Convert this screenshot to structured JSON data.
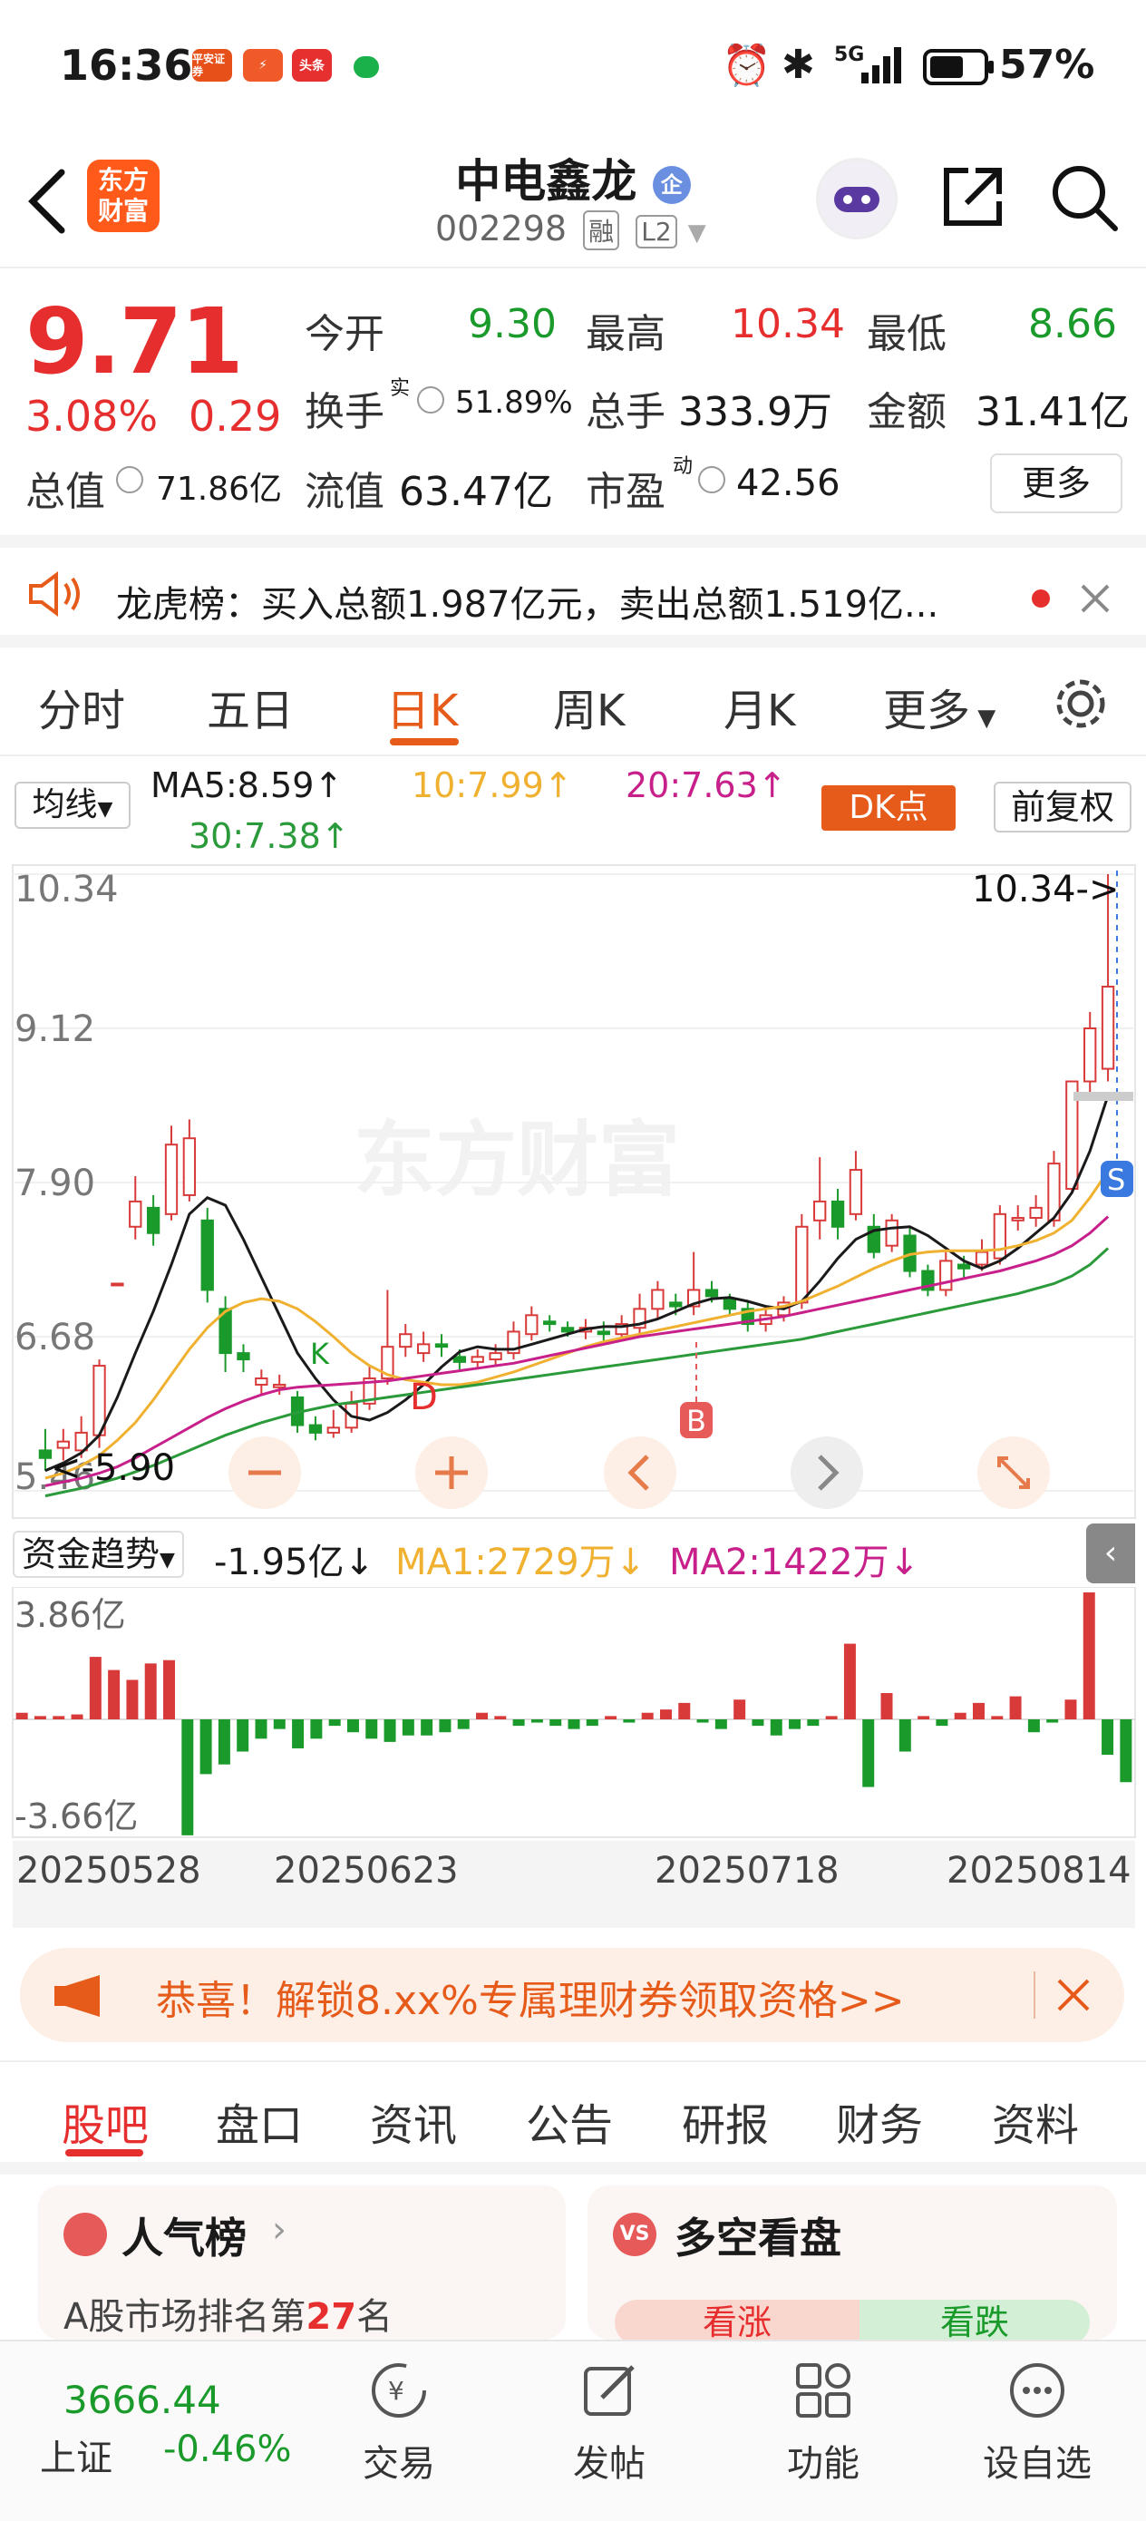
{
  "status_bar": {
    "time": "16:36",
    "apps": [
      "平安证券",
      "",
      "头条",
      ""
    ],
    "network": "5G",
    "battery": "57%"
  },
  "header": {
    "stock_name": "中电鑫龙",
    "ent_badge": "企",
    "stock_code": "002298",
    "tag_rong": "融",
    "tag_l2": "L2",
    "logo_text": "东方\n财富"
  },
  "quote": {
    "price": "9.71",
    "change_pct": "3.08%",
    "change_amt": "0.29",
    "open_label": "今开",
    "open": "9.30",
    "high_label": "最高",
    "high": "10.34",
    "low_label": "最低",
    "low": "8.66",
    "turnover_label": "换手",
    "turnover_sup": "实",
    "turnover": "51.89%",
    "volume_label": "总手",
    "volume": "333.9万",
    "amount_label": "金额",
    "amount": "31.41亿",
    "mktcap_label": "总值",
    "mktcap": "71.86亿",
    "float_label": "流值",
    "float": "63.47亿",
    "pe_label": "市盈",
    "pe_sup": "动",
    "pe": "42.56",
    "more": "更多"
  },
  "notice": {
    "text": "龙虎榜：买入总额1.987亿元，卖出总额1.519亿..."
  },
  "chart_tabs": [
    "分时",
    "五日",
    "日K",
    "周K",
    "月K",
    "更多"
  ],
  "chart_tabs_active": "日K",
  "ma": {
    "selector": "均线",
    "ma5": "MA5:8.59↑",
    "ma10": "10:7.99↑",
    "ma20": "20:7.63↑",
    "ma30": "30:7.38↑",
    "dk": "DK点",
    "fq": "前复权"
  },
  "kline": {
    "y_labels": [
      "10.34",
      "9.12",
      "7.90",
      "6.68",
      "5.46"
    ],
    "max_label": "10.34->",
    "min_label": "<-5.90",
    "marker_d": "D",
    "marker_b": "B",
    "marker_s": "S",
    "marker_k": "K",
    "watermark": "东方财富",
    "colors": {
      "up": "#d83a3a",
      "down": "#1a9a2a",
      "ma5": "#1a1a1a",
      "ma10": "#f0b030",
      "ma20": "#c8208a",
      "ma30": "#2a9a3a"
    }
  },
  "fund": {
    "selector": "资金趋势",
    "value": "-1.95亿↓",
    "ma1": "MA1:2729万↓",
    "ma2": "MA2:1422万↓",
    "ymax": "3.86亿",
    "ymin": "-3.66亿",
    "dates": [
      "20250528",
      "20250623",
      "20250718",
      "20250814"
    ]
  },
  "chart_data": [
    {
      "type": "candlestick",
      "title": "",
      "ylim": [
        5.46,
        10.34
      ],
      "y_ticks": [
        10.34,
        9.12,
        7.9,
        6.68,
        5.46
      ],
      "candles": [
        {
          "o": 5.78,
          "c": 5.72,
          "h": 5.95,
          "l": 5.62
        },
        {
          "o": 5.8,
          "c": 5.85,
          "h": 5.95,
          "l": 5.7
        },
        {
          "o": 5.78,
          "c": 5.92,
          "h": 6.05,
          "l": 5.72
        },
        {
          "o": 5.9,
          "c": 6.45,
          "h": 6.5,
          "l": 5.8
        },
        {
          "o": 7.1,
          "c": 7.1,
          "h": 7.1,
          "l": 7.1
        },
        {
          "o": 7.55,
          "c": 7.75,
          "h": 7.95,
          "l": 7.45
        },
        {
          "o": 7.7,
          "c": 7.5,
          "h": 7.8,
          "l": 7.4
        },
        {
          "o": 7.65,
          "c": 8.2,
          "h": 8.35,
          "l": 7.6
        },
        {
          "o": 7.8,
          "c": 8.25,
          "h": 8.4,
          "l": 7.75
        },
        {
          "o": 7.6,
          "c": 7.05,
          "h": 7.7,
          "l": 6.95
        },
        {
          "o": 6.9,
          "c": 6.55,
          "h": 7.0,
          "l": 6.4
        },
        {
          "o": 6.55,
          "c": 6.5,
          "h": 6.62,
          "l": 6.4
        },
        {
          "o": 6.3,
          "c": 6.35,
          "h": 6.42,
          "l": 6.22
        },
        {
          "o": 6.28,
          "c": 6.3,
          "h": 6.38,
          "l": 6.22
        },
        {
          "o": 6.2,
          "c": 5.98,
          "h": 6.25,
          "l": 5.92
        },
        {
          "o": 5.98,
          "c": 5.92,
          "h": 6.05,
          "l": 5.86
        },
        {
          "o": 5.92,
          "c": 5.96,
          "h": 6.1,
          "l": 5.88
        },
        {
          "o": 5.96,
          "c": 6.15,
          "h": 6.25,
          "l": 5.92
        },
        {
          "o": 6.15,
          "c": 6.35,
          "h": 6.45,
          "l": 6.1
        },
        {
          "o": 6.35,
          "c": 6.6,
          "h": 7.05,
          "l": 6.3
        },
        {
          "o": 6.6,
          "c": 6.7,
          "h": 6.78,
          "l": 6.52
        },
        {
          "o": 6.55,
          "c": 6.62,
          "h": 6.72,
          "l": 6.48
        },
        {
          "o": 6.62,
          "c": 6.6,
          "h": 6.7,
          "l": 6.52
        },
        {
          "o": 6.52,
          "c": 6.48,
          "h": 6.58,
          "l": 6.42
        },
        {
          "o": 6.48,
          "c": 6.52,
          "h": 6.58,
          "l": 6.42
        },
        {
          "o": 6.5,
          "c": 6.55,
          "h": 6.62,
          "l": 6.45
        },
        {
          "o": 6.55,
          "c": 6.72,
          "h": 6.8,
          "l": 6.5
        },
        {
          "o": 6.7,
          "c": 6.85,
          "h": 6.92,
          "l": 6.65
        },
        {
          "o": 6.8,
          "c": 6.78,
          "h": 6.85,
          "l": 6.72
        },
        {
          "o": 6.75,
          "c": 6.72,
          "h": 6.8,
          "l": 6.68
        },
        {
          "o": 6.72,
          "c": 6.75,
          "h": 6.82,
          "l": 6.66
        },
        {
          "o": 6.72,
          "c": 6.7,
          "h": 6.8,
          "l": 6.65
        },
        {
          "o": 6.7,
          "c": 6.78,
          "h": 6.85,
          "l": 6.65
        },
        {
          "o": 6.75,
          "c": 6.9,
          "h": 7.02,
          "l": 6.7
        },
        {
          "o": 6.9,
          "c": 7.05,
          "h": 7.12,
          "l": 6.82
        },
        {
          "o": 6.95,
          "c": 6.92,
          "h": 7.02,
          "l": 6.85
        },
        {
          "o": 6.92,
          "c": 7.05,
          "h": 7.35,
          "l": 6.85
        },
        {
          "o": 7.05,
          "c": 7.0,
          "h": 7.12,
          "l": 6.95
        },
        {
          "o": 6.98,
          "c": 6.9,
          "h": 7.02,
          "l": 6.85
        },
        {
          "o": 6.9,
          "c": 6.78,
          "h": 6.95,
          "l": 6.72
        },
        {
          "o": 6.78,
          "c": 6.85,
          "h": 6.92,
          "l": 6.72
        },
        {
          "o": 6.85,
          "c": 6.95,
          "h": 7.0,
          "l": 6.8
        },
        {
          "o": 6.95,
          "c": 7.55,
          "h": 7.65,
          "l": 6.9
        },
        {
          "o": 7.6,
          "c": 7.75,
          "h": 8.1,
          "l": 7.45
        },
        {
          "o": 7.75,
          "c": 7.55,
          "h": 7.85,
          "l": 7.45
        },
        {
          "o": 7.65,
          "c": 8.0,
          "h": 8.15,
          "l": 7.6
        },
        {
          "o": 7.55,
          "c": 7.35,
          "h": 7.65,
          "l": 7.3
        },
        {
          "o": 7.4,
          "c": 7.6,
          "h": 7.65,
          "l": 7.35
        },
        {
          "o": 7.48,
          "c": 7.2,
          "h": 7.55,
          "l": 7.15
        },
        {
          "o": 7.2,
          "c": 7.05,
          "h": 7.25,
          "l": 7.0
        },
        {
          "o": 7.05,
          "c": 7.28,
          "h": 7.35,
          "l": 7.0
        },
        {
          "o": 7.25,
          "c": 7.22,
          "h": 7.32,
          "l": 7.15
        },
        {
          "o": 7.25,
          "c": 7.35,
          "h": 7.45,
          "l": 7.2
        },
        {
          "o": 7.3,
          "c": 7.65,
          "h": 7.72,
          "l": 7.25
        },
        {
          "o": 7.6,
          "c": 7.62,
          "h": 7.72,
          "l": 7.52
        },
        {
          "o": 7.62,
          "c": 7.7,
          "h": 7.8,
          "l": 7.55
        },
        {
          "o": 7.6,
          "c": 8.05,
          "h": 8.15,
          "l": 7.55
        },
        {
          "o": 7.85,
          "c": 8.7,
          "h": 8.7,
          "l": 7.82
        },
        {
          "o": 8.7,
          "c": 9.12,
          "h": 9.25,
          "l": 8.6
        },
        {
          "o": 8.8,
          "c": 9.45,
          "h": 10.34,
          "l": 8.7
        }
      ],
      "series": [
        {
          "name": "MA5",
          "values": [
            5.62,
            5.68,
            5.76,
            5.9,
            6.2,
            6.55,
            6.88,
            7.25,
            7.65,
            7.78,
            7.72,
            7.45,
            7.15,
            6.85,
            6.55,
            6.35,
            6.18,
            6.05,
            6.02,
            6.08,
            6.18,
            6.3,
            6.44,
            6.56,
            6.6,
            6.58,
            6.58,
            6.62,
            6.66,
            6.7,
            6.74,
            6.76,
            6.76,
            6.78,
            6.82,
            6.88,
            6.94,
            6.98,
            6.99,
            6.96,
            6.92,
            6.9,
            6.96,
            7.12,
            7.3,
            7.45,
            7.52,
            7.54,
            7.55,
            7.48,
            7.38,
            7.28,
            7.22,
            7.28,
            7.38,
            7.5,
            7.62,
            7.82,
            8.15,
            8.59
          ]
        },
        {
          "name": "10",
          "values": [
            5.56,
            5.6,
            5.66,
            5.74,
            5.86,
            6.0,
            6.18,
            6.38,
            6.58,
            6.75,
            6.88,
            6.95,
            6.98,
            6.96,
            6.9,
            6.8,
            6.68,
            6.55,
            6.45,
            6.38,
            6.34,
            6.32,
            6.3,
            6.3,
            6.32,
            6.36,
            6.4,
            6.45,
            6.5,
            6.55,
            6.6,
            6.64,
            6.67,
            6.7,
            6.73,
            6.76,
            6.79,
            6.82,
            6.85,
            6.88,
            6.9,
            6.92,
            6.96,
            7.02,
            7.08,
            7.15,
            7.22,
            7.28,
            7.33,
            7.35,
            7.36,
            7.36,
            7.36,
            7.37,
            7.4,
            7.44,
            7.5,
            7.6,
            7.78,
            7.99
          ]
        },
        {
          "name": "20",
          "values": [
            5.5,
            5.53,
            5.56,
            5.6,
            5.65,
            5.72,
            5.8,
            5.88,
            5.96,
            6.04,
            6.11,
            6.17,
            6.22,
            6.26,
            6.28,
            6.29,
            6.3,
            6.31,
            6.32,
            6.33,
            6.35,
            6.37,
            6.39,
            6.41,
            6.43,
            6.45,
            6.47,
            6.5,
            6.53,
            6.56,
            6.59,
            6.62,
            6.65,
            6.68,
            6.7,
            6.72,
            6.74,
            6.76,
            6.78,
            6.8,
            6.82,
            6.84,
            6.87,
            6.9,
            6.93,
            6.96,
            6.99,
            7.02,
            7.05,
            7.08,
            7.11,
            7.14,
            7.17,
            7.2,
            7.24,
            7.28,
            7.33,
            7.4,
            7.5,
            7.63
          ]
        },
        {
          "name": "30",
          "values": [
            5.42,
            5.45,
            5.48,
            5.52,
            5.56,
            5.61,
            5.66,
            5.72,
            5.78,
            5.84,
            5.9,
            5.95,
            6.0,
            6.04,
            6.08,
            6.11,
            6.14,
            6.16,
            6.18,
            6.2,
            6.22,
            6.24,
            6.26,
            6.28,
            6.3,
            6.32,
            6.34,
            6.36,
            6.38,
            6.4,
            6.42,
            6.44,
            6.46,
            6.48,
            6.5,
            6.52,
            6.54,
            6.56,
            6.58,
            6.6,
            6.62,
            6.64,
            6.66,
            6.69,
            6.72,
            6.75,
            6.78,
            6.81,
            6.84,
            6.87,
            6.9,
            6.93,
            6.96,
            6.99,
            7.02,
            7.06,
            7.1,
            7.16,
            7.25,
            7.38
          ]
        }
      ]
    },
    {
      "type": "bar",
      "title": "",
      "ylim": [
        -3.66,
        3.86
      ],
      "categories_start": "20250528",
      "categories_end": "20250814",
      "values": [
        0.2,
        0.1,
        0.1,
        0.15,
        1.9,
        1.5,
        1.2,
        1.7,
        1.8,
        -3.6,
        -1.7,
        -1.4,
        -1.0,
        -0.6,
        -0.3,
        -0.9,
        -0.6,
        -0.2,
        -0.4,
        -0.6,
        -0.7,
        -0.5,
        -0.5,
        -0.4,
        -0.3,
        0.2,
        0.1,
        -0.2,
        -0.1,
        -0.2,
        -0.3,
        -0.2,
        0.1,
        -0.1,
        0.2,
        0.3,
        0.5,
        -0.1,
        -0.3,
        0.6,
        -0.2,
        -0.5,
        -0.3,
        -0.2,
        0.1,
        2.3,
        -2.1,
        0.8,
        -1.0,
        0.1,
        -0.2,
        0.2,
        0.5,
        0.1,
        0.7,
        -0.4,
        -0.1,
        0.6,
        4.5,
        -1.1,
        -1.95
      ]
    }
  ],
  "promo": {
    "text": "恭喜！解锁8.xx%专属理财券领取资格>>"
  },
  "bottom_tabs": [
    "股吧",
    "盘口",
    "资讯",
    "公告",
    "研报",
    "财务",
    "资料"
  ],
  "bottom_tabs_active": "股吧",
  "cards": {
    "popularity_title": "人气榜",
    "popularity_text_prefix": "A股市场排名第",
    "popularity_rank": "27",
    "popularity_text_suffix": "名",
    "bullbear_title": "多空看盘",
    "bull": "看涨",
    "bear": "看跌"
  },
  "bottom_nav": {
    "index_value": "3666.44",
    "index_name": "上证",
    "index_change": "-0.46%",
    "items": [
      "交易",
      "发帖",
      "功能",
      "设自选"
    ]
  }
}
